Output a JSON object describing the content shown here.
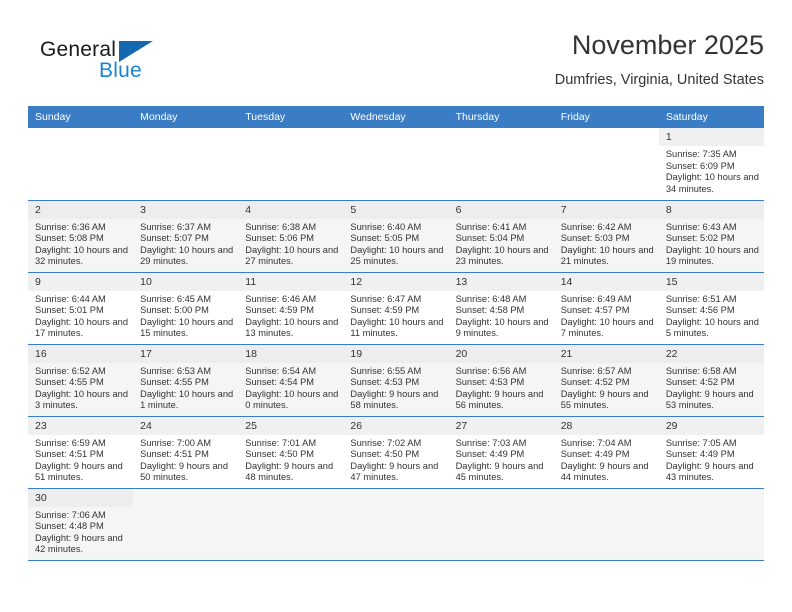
{
  "brand": {
    "name_top": "General",
    "name_bottom": "Blue",
    "triangle_icon": "triangle-logo-icon",
    "color_dark": "#1a1a1a",
    "color_blue": "#1a84d6"
  },
  "header": {
    "title": "November 2025",
    "subtitle": "Dumfries, Virginia, United States"
  },
  "theme": {
    "header_row_bg": "#3b7dc4",
    "header_row_text": "#ffffff",
    "row_alt_bg": "#f5f5f5",
    "daynum_bg": "#f0f0f0",
    "grid_line": "#3b7dc4"
  },
  "weekdays": [
    "Sunday",
    "Monday",
    "Tuesday",
    "Wednesday",
    "Thursday",
    "Friday",
    "Saturday"
  ],
  "labels": {
    "sunrise_prefix": "Sunrise:",
    "sunset_prefix": "Sunset:",
    "daylight_prefix": "Daylight:"
  },
  "weeks": [
    [
      {
        "empty": true
      },
      {
        "empty": true
      },
      {
        "empty": true
      },
      {
        "empty": true
      },
      {
        "empty": true
      },
      {
        "empty": true
      },
      {
        "day": "1",
        "sunrise": "Sunrise: 7:35 AM",
        "sunset": "Sunset: 6:09 PM",
        "daylight": "Daylight: 10 hours and 34 minutes."
      }
    ],
    [
      {
        "day": "2",
        "sunrise": "Sunrise: 6:36 AM",
        "sunset": "Sunset: 5:08 PM",
        "daylight": "Daylight: 10 hours and 32 minutes."
      },
      {
        "day": "3",
        "sunrise": "Sunrise: 6:37 AM",
        "sunset": "Sunset: 5:07 PM",
        "daylight": "Daylight: 10 hours and 29 minutes."
      },
      {
        "day": "4",
        "sunrise": "Sunrise: 6:38 AM",
        "sunset": "Sunset: 5:06 PM",
        "daylight": "Daylight: 10 hours and 27 minutes."
      },
      {
        "day": "5",
        "sunrise": "Sunrise: 6:40 AM",
        "sunset": "Sunset: 5:05 PM",
        "daylight": "Daylight: 10 hours and 25 minutes."
      },
      {
        "day": "6",
        "sunrise": "Sunrise: 6:41 AM",
        "sunset": "Sunset: 5:04 PM",
        "daylight": "Daylight: 10 hours and 23 minutes."
      },
      {
        "day": "7",
        "sunrise": "Sunrise: 6:42 AM",
        "sunset": "Sunset: 5:03 PM",
        "daylight": "Daylight: 10 hours and 21 minutes."
      },
      {
        "day": "8",
        "sunrise": "Sunrise: 6:43 AM",
        "sunset": "Sunset: 5:02 PM",
        "daylight": "Daylight: 10 hours and 19 minutes."
      }
    ],
    [
      {
        "day": "9",
        "sunrise": "Sunrise: 6:44 AM",
        "sunset": "Sunset: 5:01 PM",
        "daylight": "Daylight: 10 hours and 17 minutes."
      },
      {
        "day": "10",
        "sunrise": "Sunrise: 6:45 AM",
        "sunset": "Sunset: 5:00 PM",
        "daylight": "Daylight: 10 hours and 15 minutes."
      },
      {
        "day": "11",
        "sunrise": "Sunrise: 6:46 AM",
        "sunset": "Sunset: 4:59 PM",
        "daylight": "Daylight: 10 hours and 13 minutes."
      },
      {
        "day": "12",
        "sunrise": "Sunrise: 6:47 AM",
        "sunset": "Sunset: 4:59 PM",
        "daylight": "Daylight: 10 hours and 11 minutes."
      },
      {
        "day": "13",
        "sunrise": "Sunrise: 6:48 AM",
        "sunset": "Sunset: 4:58 PM",
        "daylight": "Daylight: 10 hours and 9 minutes."
      },
      {
        "day": "14",
        "sunrise": "Sunrise: 6:49 AM",
        "sunset": "Sunset: 4:57 PM",
        "daylight": "Daylight: 10 hours and 7 minutes."
      },
      {
        "day": "15",
        "sunrise": "Sunrise: 6:51 AM",
        "sunset": "Sunset: 4:56 PM",
        "daylight": "Daylight: 10 hours and 5 minutes."
      }
    ],
    [
      {
        "day": "16",
        "sunrise": "Sunrise: 6:52 AM",
        "sunset": "Sunset: 4:55 PM",
        "daylight": "Daylight: 10 hours and 3 minutes."
      },
      {
        "day": "17",
        "sunrise": "Sunrise: 6:53 AM",
        "sunset": "Sunset: 4:55 PM",
        "daylight": "Daylight: 10 hours and 1 minute."
      },
      {
        "day": "18",
        "sunrise": "Sunrise: 6:54 AM",
        "sunset": "Sunset: 4:54 PM",
        "daylight": "Daylight: 10 hours and 0 minutes."
      },
      {
        "day": "19",
        "sunrise": "Sunrise: 6:55 AM",
        "sunset": "Sunset: 4:53 PM",
        "daylight": "Daylight: 9 hours and 58 minutes."
      },
      {
        "day": "20",
        "sunrise": "Sunrise: 6:56 AM",
        "sunset": "Sunset: 4:53 PM",
        "daylight": "Daylight: 9 hours and 56 minutes."
      },
      {
        "day": "21",
        "sunrise": "Sunrise: 6:57 AM",
        "sunset": "Sunset: 4:52 PM",
        "daylight": "Daylight: 9 hours and 55 minutes."
      },
      {
        "day": "22",
        "sunrise": "Sunrise: 6:58 AM",
        "sunset": "Sunset: 4:52 PM",
        "daylight": "Daylight: 9 hours and 53 minutes."
      }
    ],
    [
      {
        "day": "23",
        "sunrise": "Sunrise: 6:59 AM",
        "sunset": "Sunset: 4:51 PM",
        "daylight": "Daylight: 9 hours and 51 minutes."
      },
      {
        "day": "24",
        "sunrise": "Sunrise: 7:00 AM",
        "sunset": "Sunset: 4:51 PM",
        "daylight": "Daylight: 9 hours and 50 minutes."
      },
      {
        "day": "25",
        "sunrise": "Sunrise: 7:01 AM",
        "sunset": "Sunset: 4:50 PM",
        "daylight": "Daylight: 9 hours and 48 minutes."
      },
      {
        "day": "26",
        "sunrise": "Sunrise: 7:02 AM",
        "sunset": "Sunset: 4:50 PM",
        "daylight": "Daylight: 9 hours and 47 minutes."
      },
      {
        "day": "27",
        "sunrise": "Sunrise: 7:03 AM",
        "sunset": "Sunset: 4:49 PM",
        "daylight": "Daylight: 9 hours and 45 minutes."
      },
      {
        "day": "28",
        "sunrise": "Sunrise: 7:04 AM",
        "sunset": "Sunset: 4:49 PM",
        "daylight": "Daylight: 9 hours and 44 minutes."
      },
      {
        "day": "29",
        "sunrise": "Sunrise: 7:05 AM",
        "sunset": "Sunset: 4:49 PM",
        "daylight": "Daylight: 9 hours and 43 minutes."
      }
    ],
    [
      {
        "day": "30",
        "sunrise": "Sunrise: 7:06 AM",
        "sunset": "Sunset: 4:48 PM",
        "daylight": "Daylight: 9 hours and 42 minutes."
      },
      {
        "empty": true
      },
      {
        "empty": true
      },
      {
        "empty": true
      },
      {
        "empty": true
      },
      {
        "empty": true
      },
      {
        "empty": true
      }
    ]
  ]
}
